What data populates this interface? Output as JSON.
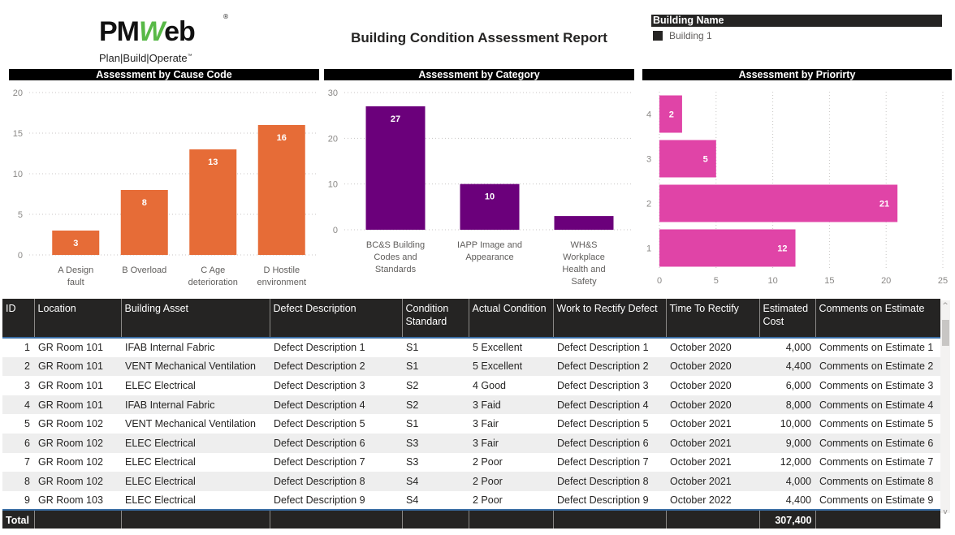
{
  "header": {
    "logo_brand_prefix": "PM",
    "logo_brand_w": "W",
    "logo_brand_suffix": "eb",
    "logo_registered": "®",
    "logo_tagline": "Plan|Build|Operate",
    "logo_tm": "™",
    "title": "Building Condition Assessment Report"
  },
  "slicer": {
    "header": "Building Name",
    "items": [
      {
        "label": "Building 1",
        "selected": true
      }
    ]
  },
  "chart_data": [
    {
      "type": "bar",
      "orientation": "vertical",
      "title": "Assessment by Cause Code",
      "categories": [
        "A Design fault",
        "B Overload",
        "C Age deterioration",
        "D Hostile environment"
      ],
      "category_lines": [
        [
          "A Design",
          "fault"
        ],
        [
          "B Overload"
        ],
        [
          "C Age",
          "deterioration"
        ],
        [
          "D Hostile",
          "environment"
        ]
      ],
      "values": [
        3,
        8,
        13,
        16
      ],
      "data_labels": [
        "3",
        "8",
        "13",
        "16"
      ],
      "yticks": [
        0,
        5,
        10,
        15,
        20
      ],
      "ylim": [
        0,
        20
      ],
      "color": "#e66c37",
      "grid": true,
      "xlabel": "",
      "ylabel": ""
    },
    {
      "type": "bar",
      "orientation": "vertical",
      "title": "Assessment by Category",
      "categories": [
        "BC&S Building Codes and Standards",
        "IAPP Image and Appearance",
        "WH&S Workplace Health and Safety"
      ],
      "category_lines": [
        [
          "BC&S Building",
          "Codes and",
          "Standards"
        ],
        [
          "IAPP Image and",
          "Appearance"
        ],
        [
          "WH&S",
          "Workplace",
          "Health and",
          "Safety"
        ]
      ],
      "values": [
        27,
        10,
        3
      ],
      "data_labels": [
        "27",
        "10",
        ""
      ],
      "yticks": [
        0,
        10,
        20,
        30
      ],
      "ylim": [
        0,
        30
      ],
      "color": "#6b007b",
      "grid": true,
      "xlabel": "",
      "ylabel": ""
    },
    {
      "type": "bar",
      "orientation": "horizontal",
      "title": "Assessment by Priorirty",
      "categories": [
        "4",
        "3",
        "2",
        "1"
      ],
      "values": [
        2,
        5,
        21,
        12
      ],
      "data_labels": [
        "2",
        "5",
        "21",
        "12"
      ],
      "xticks": [
        0,
        5,
        10,
        15,
        20,
        25
      ],
      "xlim": [
        0,
        25
      ],
      "color": "#e044a7",
      "grid": true,
      "xlabel": "",
      "ylabel": ""
    }
  ],
  "table": {
    "columns": [
      "ID",
      "Location",
      "Building Asset",
      "Defect Description",
      "Condition Standard",
      "Actual Condition",
      "Work to Rectify Defect",
      "Time To Rectify",
      "Estimated Cost",
      "Comments on Estimate"
    ],
    "rows": [
      [
        "1",
        "GR Room 101",
        "IFAB Internal Fabric",
        "Defect Description 1",
        "S1",
        "5 Excellent",
        "Defect Description 1",
        "October 2020",
        "4,000",
        "Comments on Estimate 1"
      ],
      [
        "2",
        "GR Room 101",
        "VENT Mechanical Ventilation",
        "Defect Description 2",
        "S1",
        "5 Excellent",
        "Defect Description 2",
        "October 2020",
        "4,400",
        "Comments on Estimate 2"
      ],
      [
        "3",
        "GR Room 101",
        "ELEC Electrical",
        "Defect Description 3",
        "S2",
        "4 Good",
        "Defect Description 3",
        "October 2020",
        "6,000",
        "Comments on Estimate 3"
      ],
      [
        "4",
        "GR Room 101",
        "IFAB Internal Fabric",
        "Defect Description 4",
        "S2",
        "3 Faid",
        "Defect Description 4",
        "October 2020",
        "8,000",
        "Comments on Estimate 4"
      ],
      [
        "5",
        "GR Room 102",
        "VENT Mechanical Ventilation",
        "Defect Description 5",
        "S1",
        "3 Fair",
        "Defect Description 5",
        "October 2021",
        "10,000",
        "Comments on Estimate 5"
      ],
      [
        "6",
        "GR Room 102",
        "ELEC Electrical",
        "Defect Description 6",
        "S3",
        "3 Fair",
        "Defect Description 6",
        "October 2021",
        "9,000",
        "Comments on Estimate 6"
      ],
      [
        "7",
        "GR Room 102",
        "ELEC Electrical",
        "Defect Description 7",
        "S3",
        "2 Poor",
        "Defect Description 7",
        "October 2021",
        "12,000",
        "Comments on Estimate 7"
      ],
      [
        "8",
        "GR Room 102",
        "ELEC Electrical",
        "Defect Description 8",
        "S4",
        "2 Poor",
        "Defect Description 8",
        "October 2021",
        "4,000",
        "Comments on Estimate 8"
      ],
      [
        "9",
        "GR Room 103",
        "ELEC Electrical",
        "Defect Description 9",
        "S4",
        "2 Poor",
        "Defect Description 9",
        "October 2022",
        "4,400",
        "Comments on Estimate 9"
      ]
    ],
    "total_label": "Total",
    "total_estimated_cost": "307,400"
  },
  "scrollbar": {
    "up_icon": "^",
    "down_icon": "v"
  }
}
